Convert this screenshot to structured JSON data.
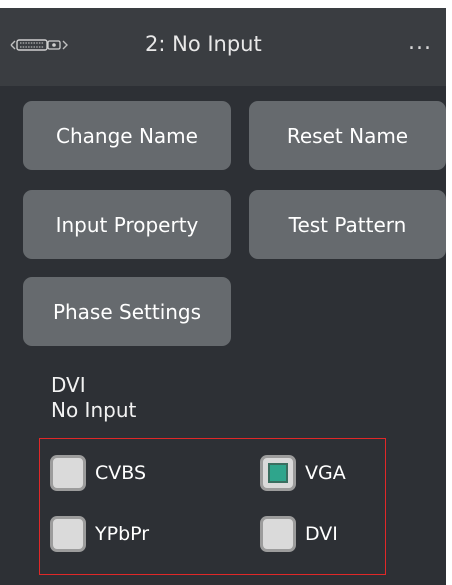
{
  "header": {
    "connector_icon": "dvi-connector-icon",
    "title": "2: No Input",
    "more_icon": "more-options-icon",
    "more_label": "..."
  },
  "actions": [
    {
      "label": "Change Name"
    },
    {
      "label": "Reset Name"
    },
    {
      "label": "Input Property"
    },
    {
      "label": "Test Pattern"
    },
    {
      "label": "Phase Settings"
    }
  ],
  "info": {
    "input_type": "DVI",
    "status": "No Input"
  },
  "signal_options": [
    {
      "label": "CVBS",
      "checked": false
    },
    {
      "label": "VGA",
      "checked": true
    },
    {
      "label": "YPbPr",
      "checked": false
    },
    {
      "label": "DVI",
      "checked": false
    }
  ],
  "colors": {
    "panel_bg": "#2d3035",
    "header_bg": "#3a3d41",
    "button_bg": "#666a6e",
    "checked_fill": "#2fa58c",
    "highlight_border": "#e02828"
  }
}
